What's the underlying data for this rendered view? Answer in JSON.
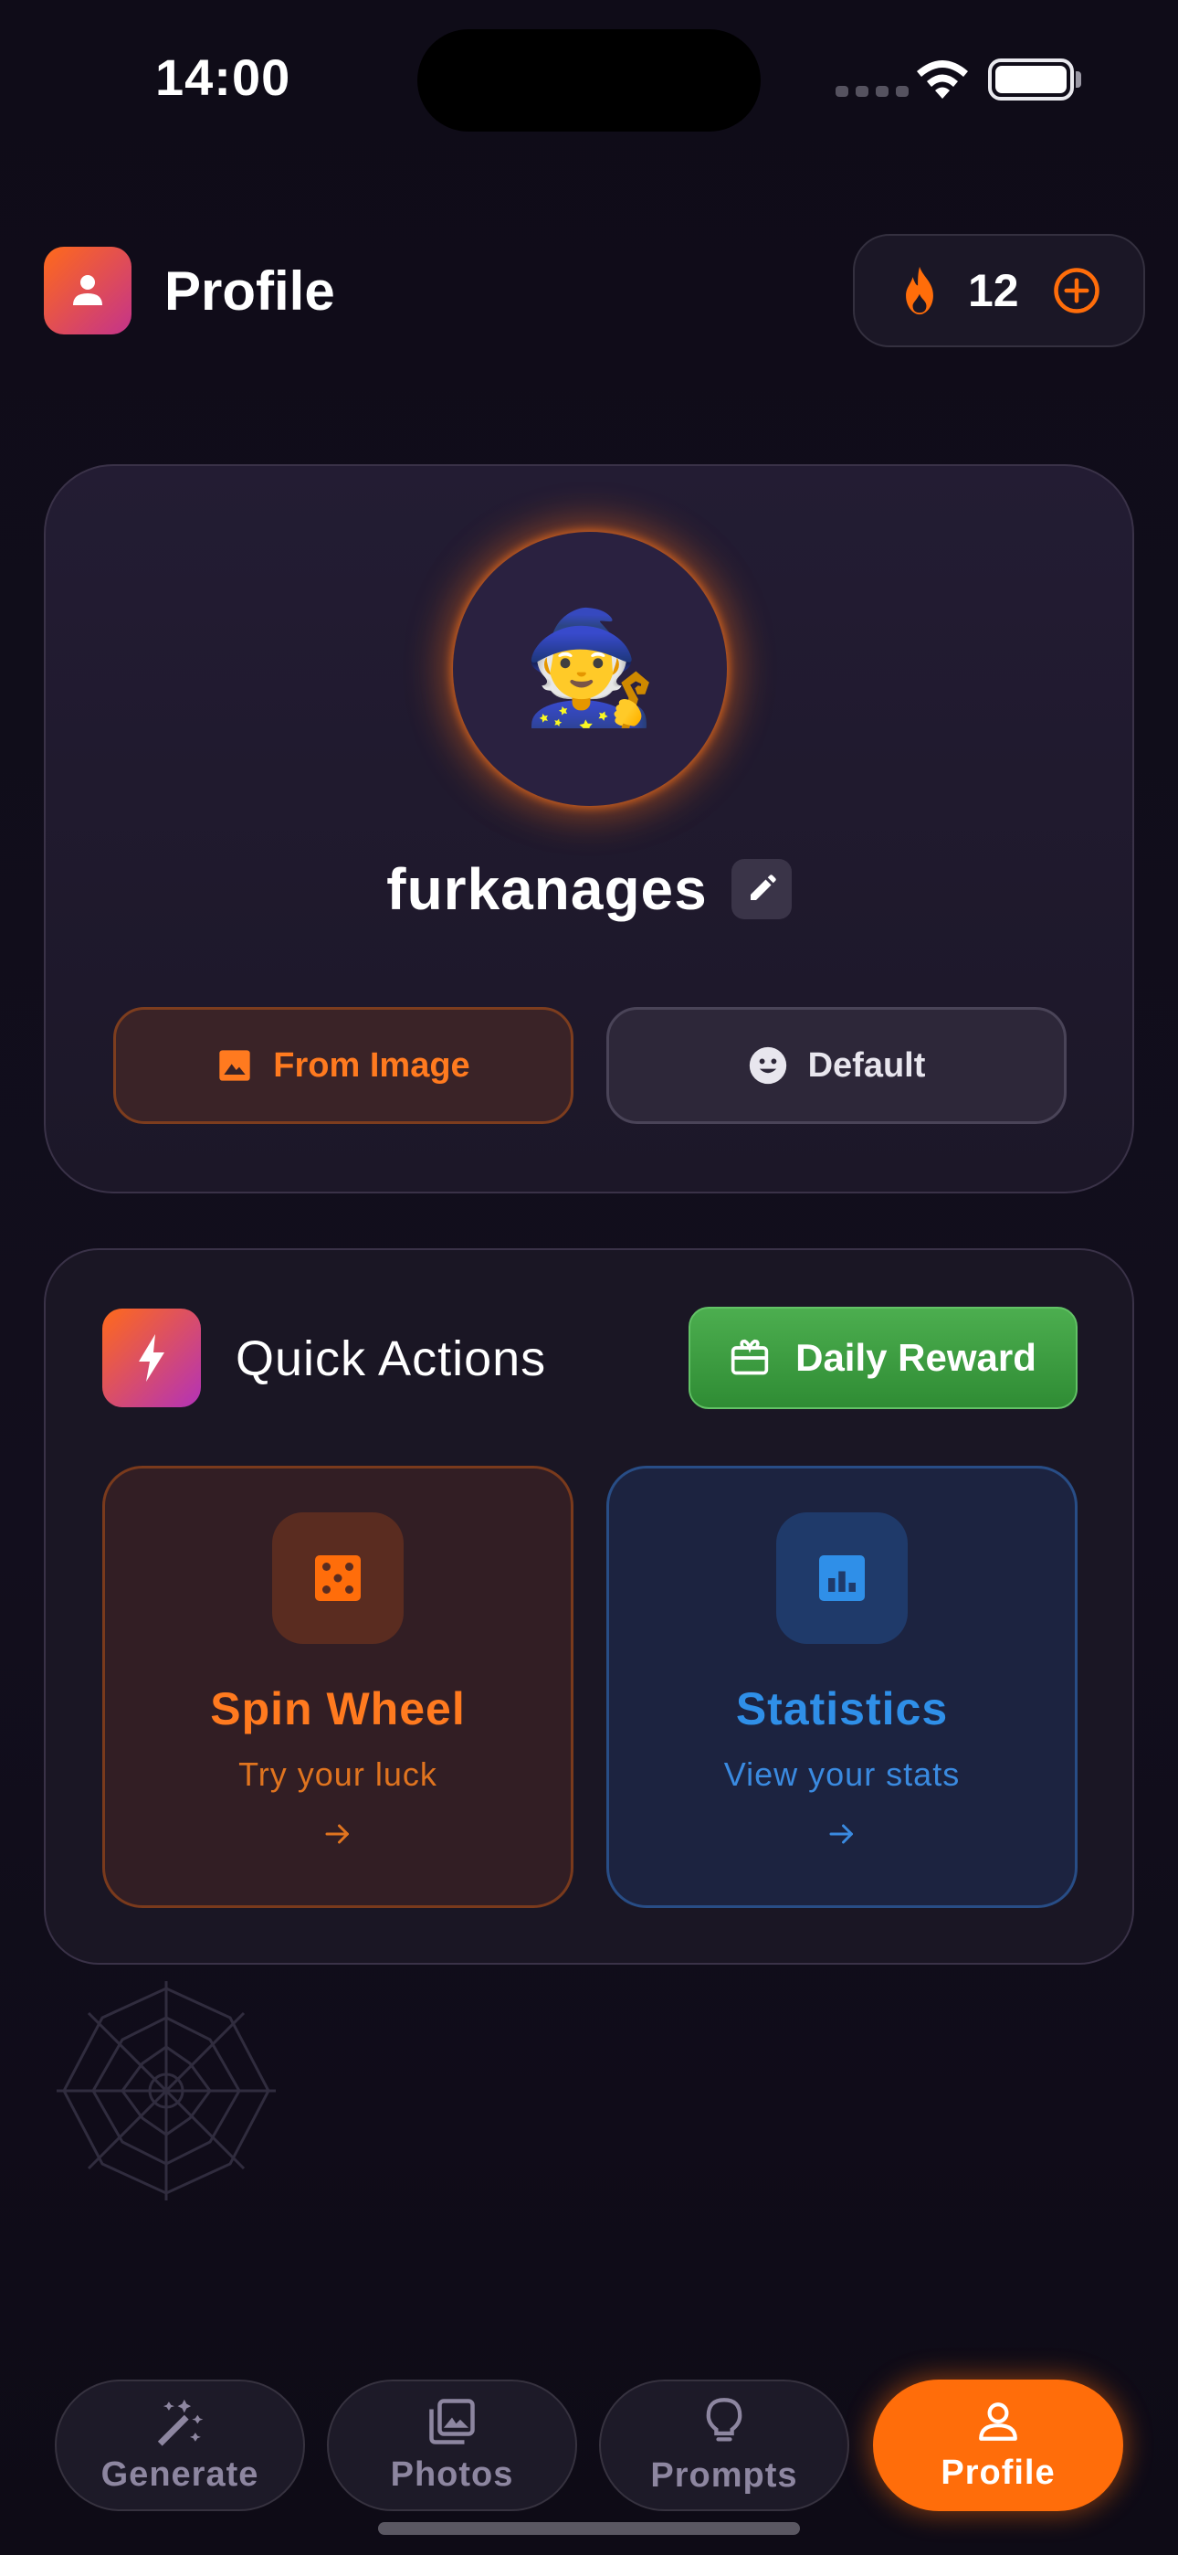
{
  "status_bar": {
    "time": "14:00"
  },
  "header": {
    "title": "Profile",
    "streak_count": "12"
  },
  "profile": {
    "avatar_emoji": "🧙",
    "username": "furkanages",
    "from_image_label": "From Image",
    "default_label": "Default"
  },
  "quick_actions": {
    "title": "Quick Actions",
    "daily_reward_label": "Daily Reward",
    "tiles": [
      {
        "title": "Spin Wheel",
        "subtitle": "Try your luck",
        "icon": "dice-icon"
      },
      {
        "title": "Statistics",
        "subtitle": "View your stats",
        "icon": "bar-chart-icon"
      }
    ]
  },
  "nav": {
    "items": [
      {
        "label": "Generate",
        "icon": "magic-wand-icon"
      },
      {
        "label": "Photos",
        "icon": "photo-library-icon"
      },
      {
        "label": "Prompts",
        "icon": "lightbulb-icon"
      },
      {
        "label": "Profile",
        "icon": "person-icon"
      }
    ],
    "active": "Profile"
  },
  "colors": {
    "accent": "#ff6d0a",
    "green": "#3f9e43",
    "blue": "#2f8fe8",
    "background": "#100d1a"
  }
}
